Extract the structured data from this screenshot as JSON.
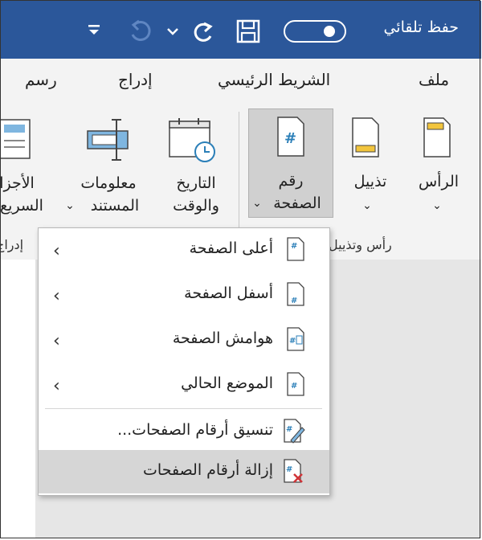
{
  "titlebar": {
    "autosave_label": "حفظ تلقائي",
    "bg_color": "#2b579a"
  },
  "menu": {
    "tabs": [
      "ملف",
      "الشريط الرئيسي",
      "إدراج",
      "رسم"
    ]
  },
  "ribbon": {
    "buttons": [
      {
        "label_line1": "الرأس",
        "label_line2": "",
        "icon": "header-icon"
      },
      {
        "label_line1": "تذييل",
        "label_line2": "",
        "icon": "footer-icon"
      },
      {
        "label_line1": "رقم",
        "label_line2": "الصفحة",
        "icon": "page-number-icon"
      },
      {
        "label_line1": "التاريخ",
        "label_line2": "والوقت",
        "icon": "calendar-clock-icon"
      },
      {
        "label_line1": "معلومات",
        "label_line2": "المستند",
        "icon": "document-info-icon"
      },
      {
        "label_line1": "الأجزا",
        "label_line2": "السريع",
        "icon": "quick-parts-icon"
      }
    ],
    "group_label_header_footer": "رأس وتذييل",
    "group_label_insert": "إدراج"
  },
  "dropdown": {
    "items": [
      {
        "label": "أعلى الصفحة",
        "has_submenu": true
      },
      {
        "label": "أسفل الصفحة",
        "has_submenu": true
      },
      {
        "label": "هوامش الصفحة",
        "has_submenu": true
      },
      {
        "label": "الموضع الحالي",
        "has_submenu": true
      },
      {
        "label": "تنسيق أرقام الصفحات...",
        "has_submenu": false
      },
      {
        "label": "إزالة أرقام الصفحات",
        "has_submenu": false
      }
    ]
  }
}
